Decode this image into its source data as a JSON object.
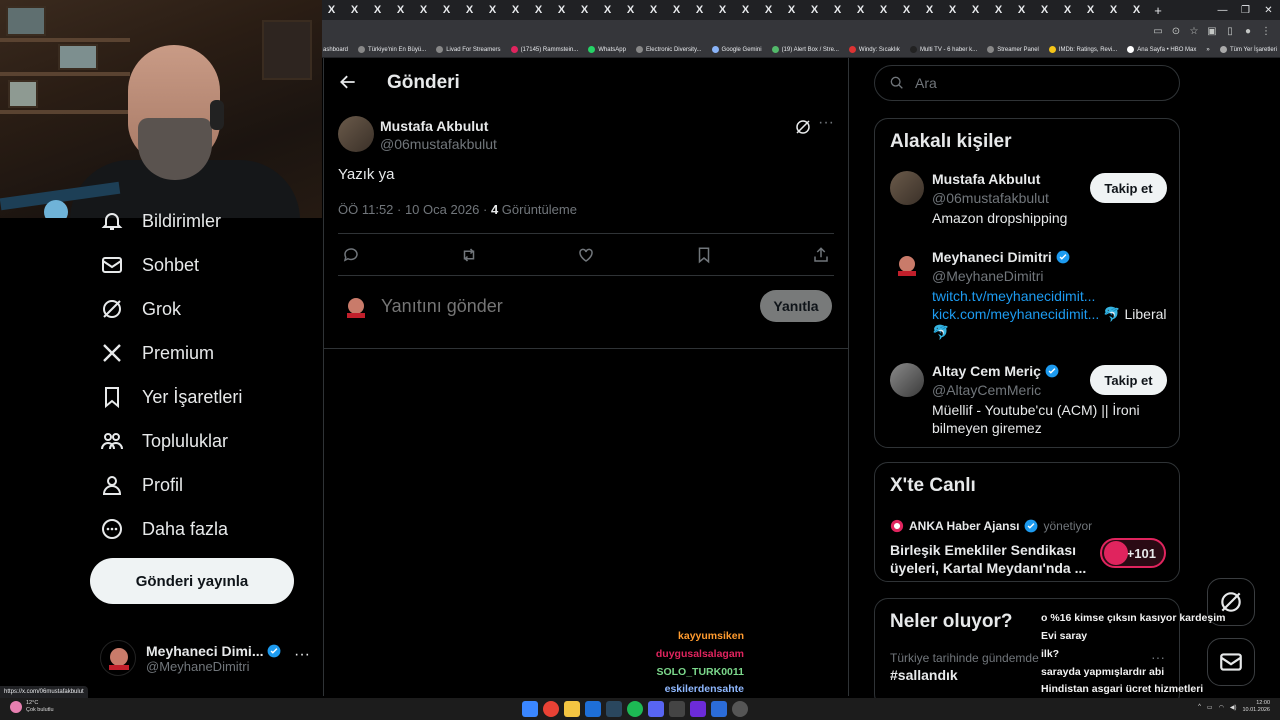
{
  "browser": {
    "tab_icon_label": "X",
    "bookmarks": [
      "ashboard",
      "Türkiye'nin En Büyü...",
      "Livad For Streamers",
      "(17145) Rammstein...",
      "WhatsApp",
      "Electronic Diversity...",
      "Google Gemini",
      "(19) Alert Box / Stre...",
      "Windy: Sıcaklık",
      "Multi TV - 6 haber k...",
      "Streamer Panel",
      "IMDb: Ratings, Revi...",
      "Ana Sayfa • HBO Max"
    ],
    "bookmarks_more": "»",
    "all_bookmarks": "Tüm Yer İşaretleri",
    "status_url": "https://x.com/06mustafakbulut"
  },
  "nav": {
    "items": [
      {
        "label": "Bildirimler",
        "icon": "bell-icon"
      },
      {
        "label": "Sohbet",
        "icon": "mail-icon"
      },
      {
        "label": "Grok",
        "icon": "grok-icon"
      },
      {
        "label": "Premium",
        "icon": "x-logo-icon"
      },
      {
        "label": "Yer İşaretleri",
        "icon": "bookmark-icon"
      },
      {
        "label": "Topluluklar",
        "icon": "communities-icon"
      },
      {
        "label": "Profil",
        "icon": "person-icon"
      },
      {
        "label": "Daha fazla",
        "icon": "more-circle-icon"
      }
    ],
    "post_button": "Gönderi yayınla",
    "account": {
      "name": "Meyhaneci Dimi...",
      "handle": "@MeyhaneDimitri",
      "more": "···"
    }
  },
  "main": {
    "title": "Gönderi",
    "tweet": {
      "author": "Mustafa Akbulut",
      "handle": "@06mustafakbulut",
      "text": "Yazık ya",
      "timestamp": "ÖÖ 11:52 · 10 Oca 2026 · ",
      "views_count": "4",
      "views_label": " Görüntüleme",
      "more": "···"
    },
    "reply": {
      "placeholder": "Yanıtını gönder",
      "button": "Yanıtla"
    }
  },
  "right": {
    "search_placeholder": "Ara",
    "related": {
      "title": "Alakalı kişiler",
      "people": [
        {
          "name": "Mustafa Akbulut",
          "handle": "@06mustafakbulut",
          "bio": "Amazon dropshipping",
          "follow": "Takip et"
        },
        {
          "name": "Meyhaneci Dimitri",
          "handle": "@MeyhaneDimitri",
          "link1": "twitch.tv/meyhanecidimit...",
          "link2": "kick.com/meyhanecidimit...",
          "bio_tail": " 🐬 Liberal 🐬"
        },
        {
          "name": "Altay Cem Meriç",
          "handle": "@AltayCemMeric",
          "bio": "Müellif - Youtube'cu (ACM) || İroni bilmeyen giremez",
          "follow": "Takip et"
        }
      ]
    },
    "live": {
      "title": "X'te Canlı",
      "host": "ANKA Haber Ajansı",
      "host_role": "yönetiyor",
      "headline": "Birleşik Emekliler Sendikası üyeleri, Kartal Meydanı'nda ...",
      "count": "+101"
    },
    "trends": {
      "title": "Neler oluyor?",
      "subtitle": "Türkiye tarihinde gündemde",
      "name": "#sallandık",
      "more": "···"
    }
  },
  "chat": [
    {
      "user": "",
      "msg": "o %16 kimse çıksın kasıyor kardeşim",
      "color": "#9b6ad8"
    },
    {
      "user": "kayyumsiken",
      "msg": "Evi saray",
      "color": "#ff9b2f"
    },
    {
      "user": "duygusalsalagam",
      "msg": "ilk?",
      "color": "#e0245e"
    },
    {
      "user": "SOLO_TURK0011",
      "msg": "sarayda yapmışlardır abi",
      "color": "#7cd88c"
    },
    {
      "user": "eskilerdensahte",
      "msg": "Hindistan asgari ücret hizmetleri",
      "color": "#8fb8ff"
    }
  ],
  "taskbar": {
    "weather_temp": "12°C",
    "weather_desc": "Çok bulutlu",
    "time": "12:00",
    "date": "10.01.2026"
  },
  "colors": {
    "accent": "#1d9bf0",
    "background": "#000000",
    "border": "#2f3336",
    "muted": "#71767b",
    "live_red": "#e0245e"
  }
}
